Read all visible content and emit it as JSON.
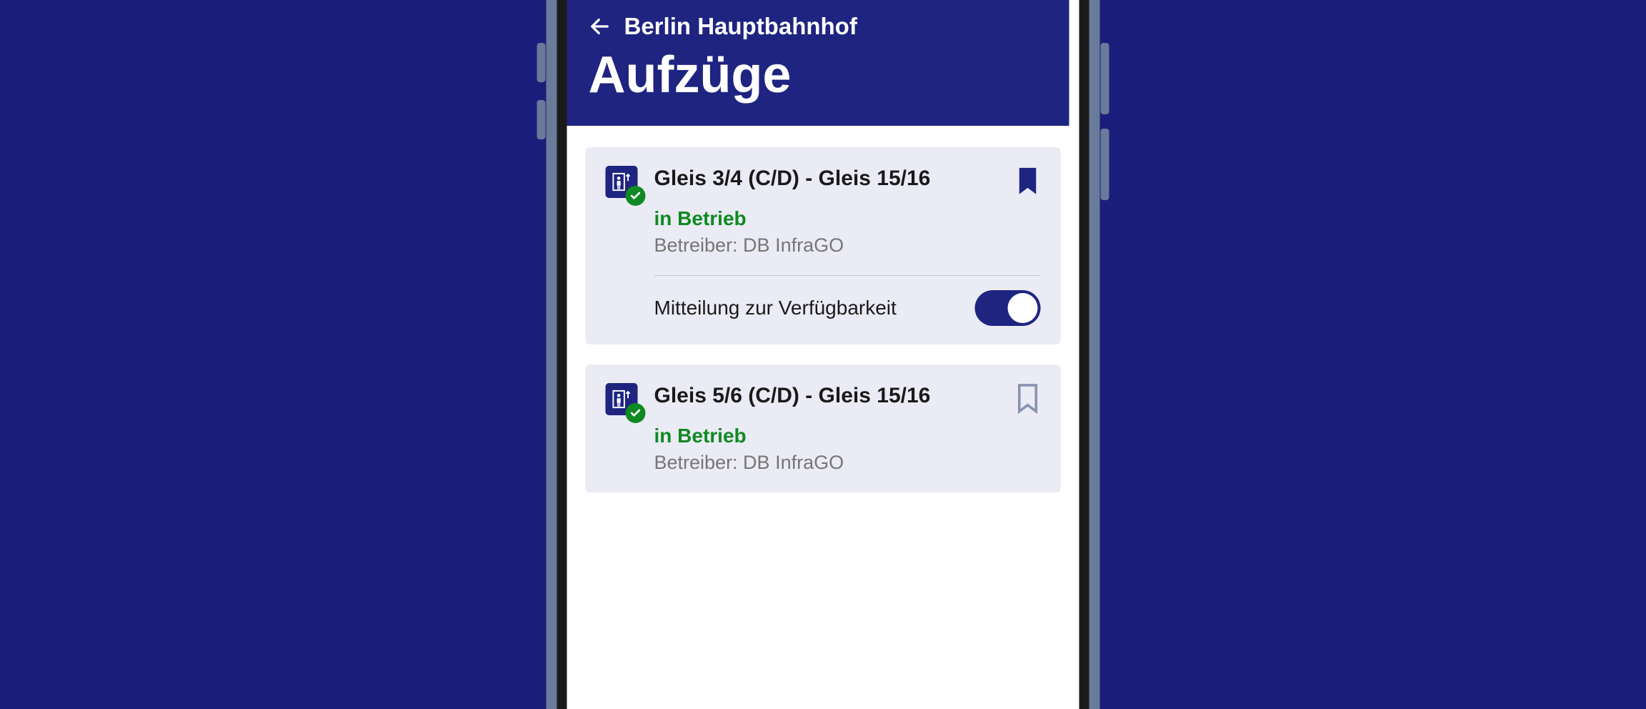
{
  "header": {
    "location": "Berlin Hauptbahnhof",
    "title": "Aufzüge"
  },
  "cards": [
    {
      "title": "Gleis 3/4 (C/D) - Gleis 15/16",
      "status": "in Betrieb",
      "operator": "Betreiber: DB InfraGO",
      "bookmarked": true,
      "toggle_label": "Mitteilung zur Verfügbarkeit",
      "toggle_on": true
    },
    {
      "title": "Gleis 5/6 (C/D) - Gleis 15/16",
      "status": "in Betrieb",
      "operator": "Betreiber: DB InfraGO",
      "bookmarked": false
    }
  ]
}
